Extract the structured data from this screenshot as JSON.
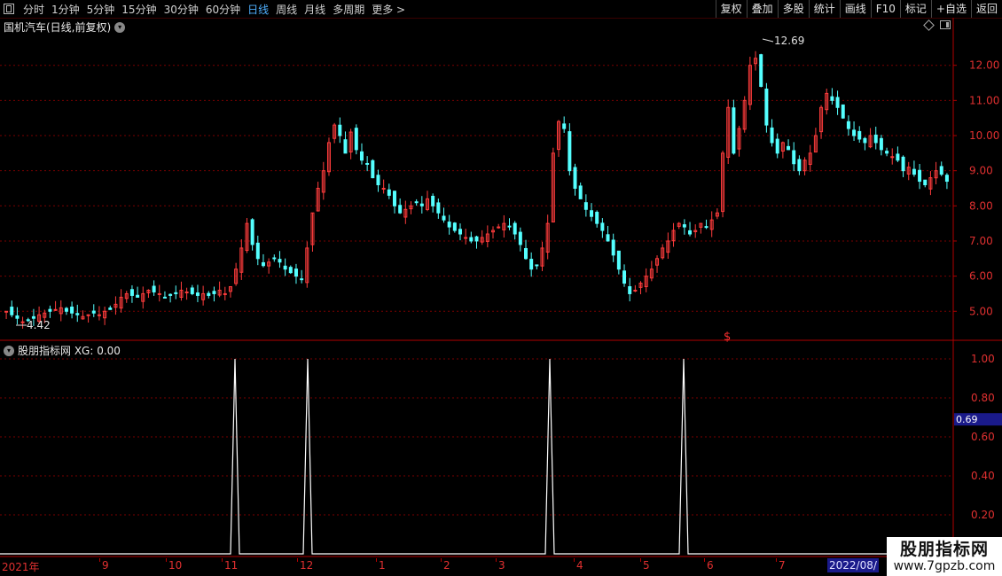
{
  "toolbar": {
    "periods": [
      "分时",
      "1分钟",
      "5分钟",
      "15分钟",
      "30分钟",
      "60分钟",
      "日线",
      "周线",
      "月线",
      "多周期",
      "更多 >"
    ],
    "active_period": "日线",
    "right_buttons": [
      "复权",
      "叠加",
      "多股",
      "统计",
      "画线",
      "F10",
      "标记",
      "+自选",
      "返回"
    ]
  },
  "price_panel": {
    "title": "国机汽车(日线,前复权)",
    "high_label": "12.69",
    "low_label": "4.42",
    "axis_ticks": [
      "12.00",
      "11.00",
      "10.00",
      "9.00",
      "8.00",
      "7.00",
      "6.00",
      "5.00"
    ],
    "signal_mark": "$"
  },
  "indicator_panel": {
    "title": "股朋指标网 XG: 0.00",
    "axis_ticks": [
      "1.00",
      "0.80",
      "0.60",
      "0.40",
      "0.20"
    ],
    "current_value": "0.69"
  },
  "date_axis": {
    "labels": [
      "2021年",
      "9",
      "10",
      "11",
      "12",
      "1",
      "2",
      "3",
      "4",
      "5",
      "6",
      "7"
    ],
    "current_date": "2022/08/"
  },
  "watermark": {
    "line1": "股朋指标网",
    "line2": "www.7gpzb.com"
  },
  "colors": {
    "up": "#ff3c3c",
    "down": "#54ffff",
    "grid": "#7a0000",
    "axis_text": "#e03030"
  },
  "chart_data": {
    "type": "candlestick",
    "price_range": [
      4.2,
      12.9
    ],
    "closes": [
      5.0,
      4.9,
      4.8,
      4.7,
      4.75,
      4.8,
      4.9,
      4.95,
      5.0,
      5.05,
      5.1,
      5.0,
      4.95,
      4.9,
      4.85,
      4.9,
      4.95,
      4.9,
      5.0,
      5.05,
      5.2,
      5.4,
      5.5,
      5.45,
      5.4,
      5.5,
      5.6,
      5.55,
      5.5,
      5.4,
      5.45,
      5.5,
      5.6,
      5.55,
      5.5,
      5.45,
      5.5,
      5.45,
      5.5,
      5.6,
      5.5,
      5.7,
      6.2,
      6.8,
      7.5,
      6.9,
      6.5,
      6.3,
      6.4,
      6.5,
      6.4,
      6.2,
      6.1,
      6.0,
      5.9,
      6.8,
      7.8,
      8.5,
      9.0,
      9.8,
      10.3,
      10.0,
      9.5,
      10.1,
      9.6,
      9.3,
      9.2,
      8.8,
      8.6,
      8.5,
      8.3,
      8.0,
      7.8,
      7.9,
      8.0,
      8.1,
      8.0,
      8.2,
      8.0,
      7.8,
      7.6,
      7.4,
      7.3,
      7.2,
      7.1,
      7.0,
      7.0,
      7.1,
      7.2,
      7.3,
      7.4,
      7.5,
      7.4,
      7.2,
      6.9,
      6.5,
      6.2,
      6.3,
      6.8,
      7.5,
      9.5,
      10.4,
      10.2,
      9.0,
      8.5,
      8.2,
      7.9,
      7.7,
      7.5,
      7.3,
      7.0,
      6.6,
      6.2,
      5.8,
      5.5,
      5.6,
      5.8,
      6.0,
      6.2,
      6.5,
      6.8,
      7.0,
      7.3,
      7.5,
      7.4,
      7.2,
      7.3,
      7.5,
      7.4,
      7.6,
      7.8,
      9.5,
      10.8,
      9.5,
      10.2,
      11.0,
      12.0,
      12.2,
      11.4,
      10.3,
      9.8,
      9.5,
      9.8,
      9.6,
      9.2,
      9.0,
      9.3,
      9.5,
      10.0,
      10.8,
      11.2,
      11.0,
      10.8,
      10.5,
      10.2,
      10.0,
      9.9,
      9.8,
      10.0,
      9.8,
      9.6,
      9.5,
      9.4,
      9.3,
      9.0,
      9.1,
      8.9,
      8.7,
      8.6,
      8.8,
      9.0,
      8.9,
      8.7
    ]
  },
  "xg_signals": [
    265,
    347,
    620,
    771
  ]
}
